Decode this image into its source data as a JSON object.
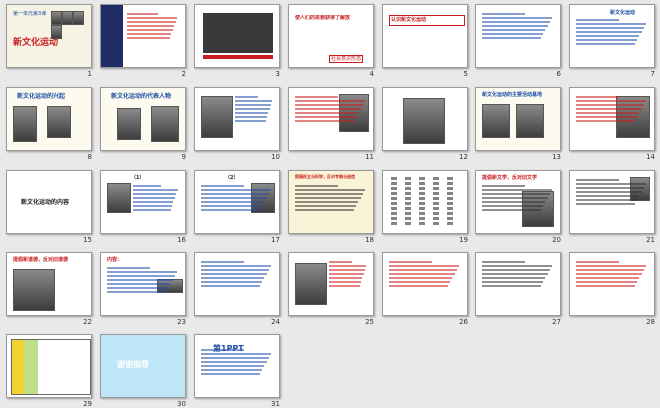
{
  "window": {
    "view": "slide-sorter"
  },
  "slides": [
    {
      "number": "1",
      "title": "新文化运动",
      "subtitle": "第一单元第3课"
    },
    {
      "number": "2",
      "title": ""
    },
    {
      "number": "3",
      "title": ""
    },
    {
      "number": "4",
      "title": "",
      "text": "使人们的思想获得了解放",
      "caption": "社会意识形态"
    },
    {
      "number": "5",
      "title": "",
      "text": "认识新文化运动"
    },
    {
      "number": "6",
      "title": ""
    },
    {
      "number": "7",
      "title": "新文化运动"
    },
    {
      "number": "8",
      "title": "新文化运动的兴起"
    },
    {
      "number": "9",
      "title": "新文化运动的代表人物"
    },
    {
      "number": "10",
      "title": ""
    },
    {
      "number": "11",
      "title": ""
    },
    {
      "number": "12",
      "title": ""
    },
    {
      "number": "13",
      "title": "新文化运动的主要活动基地"
    },
    {
      "number": "14",
      "title": ""
    },
    {
      "number": "15",
      "title": "新文化运动的内容"
    },
    {
      "number": "16",
      "title": "（1）"
    },
    {
      "number": "17",
      "title": "（2）"
    },
    {
      "number": "18",
      "title": "提倡民主与科学，反对专制与迷信"
    },
    {
      "number": "19",
      "title": ""
    },
    {
      "number": "20",
      "title": "提倡新文学，反对旧文学"
    },
    {
      "number": "21",
      "title": ""
    },
    {
      "number": "22",
      "title": "提倡新道德，反对旧道德"
    },
    {
      "number": "23",
      "title": "内容："
    },
    {
      "number": "24",
      "title": ""
    },
    {
      "number": "25",
      "title": ""
    },
    {
      "number": "26",
      "title": ""
    },
    {
      "number": "27",
      "title": ""
    },
    {
      "number": "28",
      "title": ""
    },
    {
      "number": "29",
      "title": ""
    },
    {
      "number": "30",
      "title": "谢谢指导"
    },
    {
      "number": "31",
      "title": "第1PPT"
    }
  ],
  "colors": {
    "background": "#e9e9ea",
    "slide_bg": "#ffffff",
    "title_red": "#c81e1e",
    "accent_blue": "#1f4fa8",
    "selection": "#f0a030"
  }
}
